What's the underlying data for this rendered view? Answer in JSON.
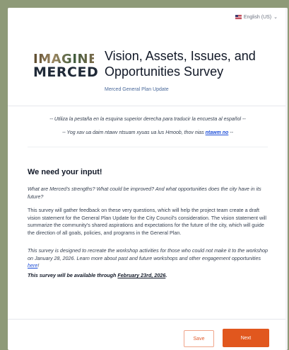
{
  "language": {
    "label": "English (US)",
    "flag_icon": "us-flag-icon",
    "chevron_icon": "chevron-down-icon"
  },
  "header": {
    "logo_line1": "IMAGINE",
    "logo_line2": "MERCED",
    "title_line1": "Vision, Assets, Issues, and",
    "title_line2": "Opportunities Survey",
    "subtitle": "Merced General Plan Update"
  },
  "translation": {
    "spanish": "-- Utiliza la pestaña en la esquina superior derecha para traducir la encuesta al español --",
    "hmong_prefix": "-- Yog xav ua daim ntawv ntsuam xyuas ua lus Hmoob, thov nias ",
    "hmong_link": "ntawm no",
    "hmong_suffix": " --"
  },
  "intro": {
    "heading": "We need your input!",
    "p1": "What are Merced's strengths? What could be improved? And what opportunities does the city have in its future?",
    "p2": "This survey will gather feedback on these very questions, which will help the project team create a draft vision statement for the General Plan Update for the City Council's consideration. The vision statement will summarize the community's shared aspirations and expectations for the future of the city, which will guide the direction of all goals, policies, and programs in the General Plan.",
    "p3_prefix": "This survey is designed to recreate the workshop activities for those who could not make it to the workshop on January 28, 2026. Learn more about past and future workshops and other engagement opportunities ",
    "p3_link": "here",
    "p3_suffix": "!",
    "p4_prefix": "This survey will be available through ",
    "p4_date": "February 23rd, 2026",
    "p4_suffix": "."
  },
  "actions": {
    "save": "Save",
    "next": "Next"
  },
  "colors": {
    "accent": "#e1571e",
    "background": "#8e9a78",
    "link": "#1d4ed8"
  }
}
